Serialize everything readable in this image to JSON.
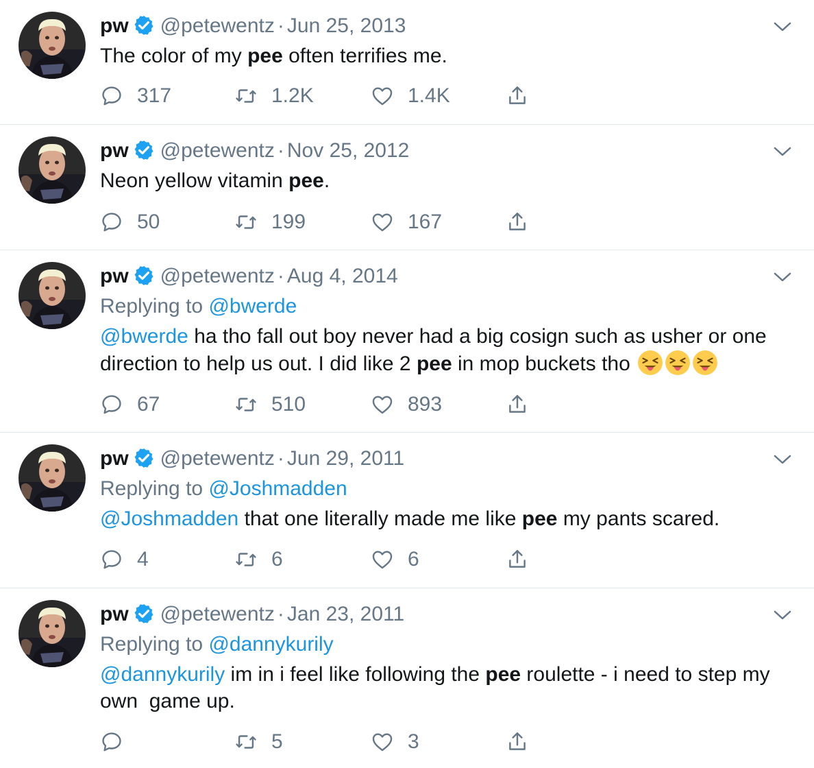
{
  "tweets": [
    {
      "name": "pw",
      "handle": "@petewentz",
      "separator": "·",
      "date": "Jun 25, 2013",
      "replying_prefix": "",
      "replying_to": "",
      "mention": "",
      "text_before": "The color of my ",
      "bold": "pee",
      "text_after": " often terrifies me.",
      "emojis": 0,
      "replies": "317",
      "retweets": "1.2K",
      "likes": "1.4K"
    },
    {
      "name": "pw",
      "handle": "@petewentz",
      "separator": "·",
      "date": "Nov 25, 2012",
      "replying_prefix": "",
      "replying_to": "",
      "mention": "",
      "text_before": "Neon yellow vitamin ",
      "bold": "pee",
      "text_after": ".",
      "emojis": 0,
      "replies": "50",
      "retweets": "199",
      "likes": "167"
    },
    {
      "name": "pw",
      "handle": "@petewentz",
      "separator": "·",
      "date": "Aug 4, 2014",
      "replying_prefix": "Replying to ",
      "replying_to": "@bwerde",
      "mention": "@bwerde",
      "text_before": " ha tho fall out boy never had a big cosign such as usher or one direction to help us out. I did like 2 ",
      "bold": "pee",
      "text_after": " in mop buckets tho ",
      "emojis": 3,
      "emoji_name": "squinting-face-with-tongue-emoji",
      "replies": "67",
      "retweets": "510",
      "likes": "893"
    },
    {
      "name": "pw",
      "handle": "@petewentz",
      "separator": "·",
      "date": "Jun 29, 2011",
      "replying_prefix": "Replying to ",
      "replying_to": "@Joshmadden",
      "mention": "@Joshmadden",
      "text_before": " that one literally made me like ",
      "bold": "pee",
      "text_after": " my pants scared.",
      "emojis": 0,
      "replies": "4",
      "retweets": "6",
      "likes": "6"
    },
    {
      "name": "pw",
      "handle": "@petewentz",
      "separator": "·",
      "date": "Jan 23, 2011",
      "replying_prefix": "Replying to ",
      "replying_to": "@dannykurily",
      "mention": "@dannykurily",
      "text_before": " im in i feel like following the ",
      "bold": "pee",
      "text_after": " roulette - i need to step my own  game up.",
      "emojis": 0,
      "replies": "",
      "retweets": "5",
      "likes": "3"
    }
  ],
  "icons": {
    "verified": "verified-badge-icon",
    "more": "chevron-down-icon",
    "reply": "reply-icon",
    "retweet": "retweet-icon",
    "like": "heart-icon",
    "share": "share-icon"
  },
  "colors": {
    "link": "#1b95e0",
    "muted": "#657786",
    "verified": "#1da1f2",
    "divider": "#e1e8ed"
  }
}
